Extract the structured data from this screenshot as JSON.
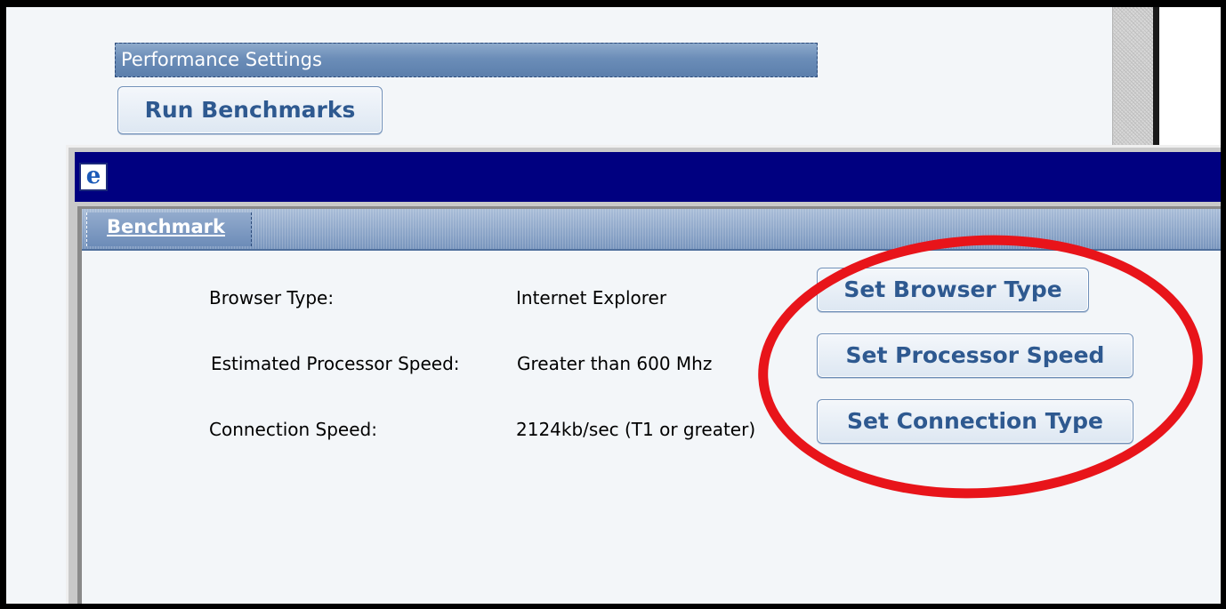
{
  "background_page": {
    "section_header": "Performance Settings",
    "run_button_label": "Run Benchmarks"
  },
  "popup": {
    "title_icon": "internet-explorer-icon",
    "tab": {
      "label": "Benchmark"
    },
    "rows": [
      {
        "label": "Browser Type:",
        "value": "Internet Explorer",
        "button_label": "Set Browser Type"
      },
      {
        "label": "Estimated Processor Speed:",
        "value": "Greater than 600 Mhz",
        "button_label": "Set Processor Speed"
      },
      {
        "label": "Connection Speed:",
        "value": "2124kb/sec (T1 or greater)",
        "button_label": "Set Connection Type"
      }
    ]
  },
  "colors": {
    "title_bar": "#000080",
    "button_text": "#2e5990",
    "annotation": "#e8141a",
    "header_bar": "#6b8db8"
  }
}
